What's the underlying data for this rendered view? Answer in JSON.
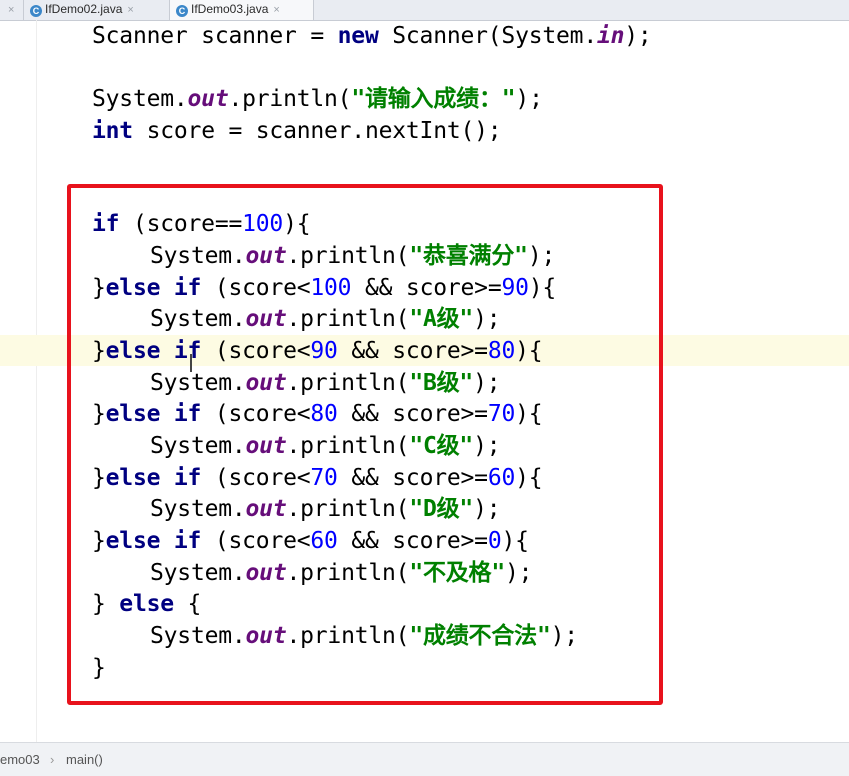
{
  "tabs": [
    {
      "label": "",
      "close": "×",
      "active": false
    },
    {
      "label": "IfDemo02.java",
      "icon": "C",
      "close": "×",
      "active": false
    },
    {
      "label": "IfDemo03.java",
      "icon": "C",
      "close": "×",
      "active": true
    }
  ],
  "code": {
    "l1": {
      "t1": "Scanner scanner = ",
      "kw": "new",
      "t2": " Scanner(System.",
      "fld": "in",
      "t3": ");"
    },
    "l2": {
      "t1": "System.",
      "fld": "out",
      "t2": ".println(",
      "str": "\"请输入成绩：\"",
      "t3": ");"
    },
    "l3": {
      "kw": "int",
      "t1": " score = scanner.nextInt();"
    },
    "l4": {
      "kw": "if",
      "t1": " (score==",
      "n1": "100",
      "t2": "){"
    },
    "l5": {
      "t1": "System.",
      "fld": "out",
      "t2": ".println(",
      "str": "\"恭喜满分\"",
      "t3": ");"
    },
    "l6": {
      "t0": "}",
      "kw1": "else",
      "sp": " ",
      "kw2": "if",
      "t1": " (score<",
      "n1": "100",
      "t2": " && score>=",
      "n2": "90",
      "t3": "){"
    },
    "l7": {
      "t1": "System.",
      "fld": "out",
      "t2": ".println(",
      "str": "\"A级\"",
      "t3": ");"
    },
    "l8": {
      "t0": "}",
      "kw1": "else",
      "sp": " ",
      "kw2": "if",
      "t1": " (score<",
      "n1": "90",
      "t2": " && score>=",
      "n2": "80",
      "t3": "){"
    },
    "l9": {
      "t1": "System.",
      "fld": "out",
      "t2": ".println(",
      "str": "\"B级\"",
      "t3": ");"
    },
    "l10": {
      "t0": "}",
      "kw1": "else",
      "sp": " ",
      "kw2": "if",
      "t1": " (score<",
      "n1": "80",
      "t2": " && score>=",
      "n2": "70",
      "t3": "){"
    },
    "l11": {
      "t1": "System.",
      "fld": "out",
      "t2": ".println(",
      "str": "\"C级\"",
      "t3": ");"
    },
    "l12": {
      "t0": "}",
      "kw1": "else",
      "sp": " ",
      "kw2": "if",
      "t1": " (score<",
      "n1": "70",
      "t2": " && score>=",
      "n2": "60",
      "t3": "){"
    },
    "l13": {
      "t1": "System.",
      "fld": "out",
      "t2": ".println(",
      "str": "\"D级\"",
      "t3": ");"
    },
    "l14": {
      "t0": "}",
      "kw1": "else",
      "sp": " ",
      "kw2": "if",
      "t1": " (score<",
      "n1": "60",
      "t2": " && score>=",
      "n2": "0",
      "t3": "){"
    },
    "l15": {
      "t1": "System.",
      "fld": "out",
      "t2": ".println(",
      "str": "\"不及格\"",
      "t3": ");"
    },
    "l16": {
      "t0": "} ",
      "kw": "else",
      "t1": " {"
    },
    "l17": {
      "t1": "System.",
      "fld": "out",
      "t2": ".println(",
      "str": "\"成绩不合法\"",
      "t3": ");"
    },
    "l18": {
      "t0": "}"
    }
  },
  "breadcrumb": {
    "items": [
      "emo03",
      "main()"
    ],
    "separator": "›"
  },
  "colors": {
    "keyword": "#000080",
    "field": "#660e7a",
    "number": "#0000ff",
    "string": "#008000",
    "highlight_box": "#e8121c"
  }
}
